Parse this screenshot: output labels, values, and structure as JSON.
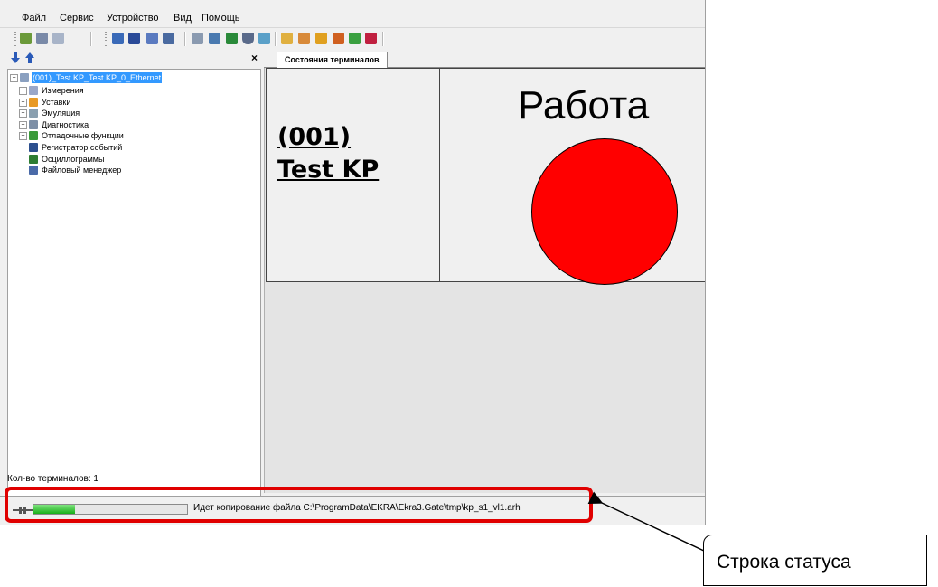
{
  "menu": [
    "Файл",
    "Сервис",
    "Устройство",
    "Вид",
    "Помощь"
  ],
  "left_panel": {
    "close_glyph": "×",
    "tree_root": "(001)_Test KP_Test KP_0_Ethernet",
    "tree_items": [
      {
        "label": "Измерения",
        "icon": "measurements-icon",
        "expandable": true,
        "color": "#9aa7c8"
      },
      {
        "label": "Уставки",
        "icon": "settings-folder-icon",
        "expandable": true,
        "color": "#e89a26"
      },
      {
        "label": "Эмуляция",
        "icon": "emulation-icon",
        "expandable": true,
        "color": "#8aa0b0"
      },
      {
        "label": "Диагностика",
        "icon": "diagnostics-icon",
        "expandable": true,
        "color": "#7d8fa6"
      },
      {
        "label": "Отладочные функции",
        "icon": "debug-functions-icon",
        "expandable": true,
        "color": "#3a9a3a"
      },
      {
        "label": "Регистратор событий",
        "icon": "event-recorder-icon",
        "expandable": false,
        "color": "#2c4f8e"
      },
      {
        "label": "Осциллограммы",
        "icon": "oscillograms-icon",
        "expandable": false,
        "color": "#2e7d32"
      },
      {
        "label": "Файловый менеджер",
        "icon": "file-manager-icon",
        "expandable": false,
        "color": "#4a6aa8"
      }
    ],
    "footer": "Кол-во терминалов: 1"
  },
  "tabs": [
    "Состояния терминалов"
  ],
  "terminal": {
    "name": "(001)\nTest KP",
    "state": "Работа",
    "state_color": "#ff0000"
  },
  "status_bar": {
    "progress": 0.27,
    "progress_color": "#19b019",
    "message": "Идет копирование файла C:\\ProgramData\\EKRA\\Ekra3.Gate\\tmp\\kp_s1_vl1.arh"
  },
  "annotation": {
    "label": "Строка статуса",
    "highlight_color": "#e00000"
  }
}
